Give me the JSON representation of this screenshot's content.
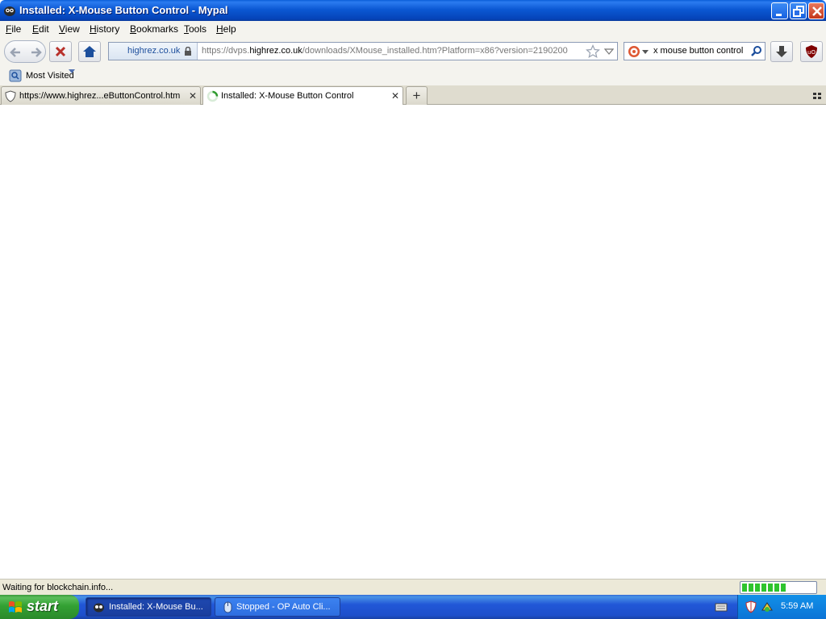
{
  "window": {
    "title": "Installed: X-Mouse Button Control - Mypal"
  },
  "menu": [
    {
      "label": "File",
      "key": "F",
      "rest": "ile"
    },
    {
      "label": "Edit",
      "key": "E",
      "rest": "dit"
    },
    {
      "label": "View",
      "key": "V",
      "rest": "iew"
    },
    {
      "label": "History",
      "key": "H",
      "rest": "istory"
    },
    {
      "label": "Bookmarks",
      "key": "B",
      "rest": "ookmarks"
    },
    {
      "label": "Tools",
      "key": "T",
      "rest": "ools"
    },
    {
      "label": "Help",
      "key": "H",
      "rest": "elp"
    }
  ],
  "navbar": {
    "identity_host": "highrez.co.uk",
    "url_prefix": "https://dvps.",
    "url_domain": "highrez.co.uk",
    "url_rest": "/downloads/XMouse_installed.htm?Platform=x86?version=2190200",
    "search_value": "x mouse button control"
  },
  "bookmarks": {
    "most_visited": "Most Visited"
  },
  "tabs": [
    {
      "label": "https://www.highrez...eButtonControl.htm",
      "active": false
    },
    {
      "label": "Installed: X-Mouse Button Control",
      "active": true
    }
  ],
  "status": {
    "text": "Waiting for blockchain.info...",
    "progress": 0.6
  },
  "taskbar": {
    "start_label": "start",
    "tasks": [
      {
        "label": "Installed: X-Mouse Bu...",
        "active": true
      },
      {
        "label": "Stopped - OP Auto Cli...",
        "active": false
      }
    ],
    "clock": "5:59 AM"
  },
  "colors": {
    "titlebar": "#0b58d3",
    "taskbar": "#2157d7",
    "start": "#33a133",
    "progress": "#2ec42e"
  }
}
